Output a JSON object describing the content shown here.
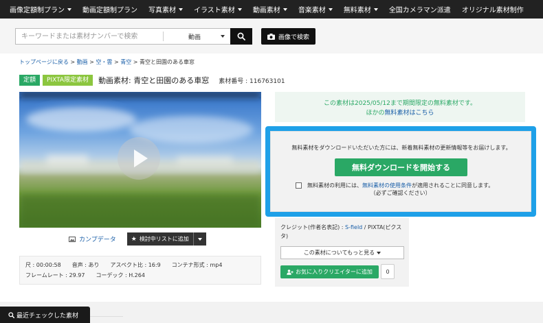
{
  "nav": {
    "items": [
      {
        "label": "画像定額制プラン",
        "dropdown": true
      },
      {
        "label": "動画定額制プラン",
        "dropdown": false
      },
      {
        "label": "写真素材",
        "dropdown": true
      },
      {
        "label": "イラスト素材",
        "dropdown": true
      },
      {
        "label": "動画素材",
        "dropdown": true
      },
      {
        "label": "音楽素材",
        "dropdown": true
      },
      {
        "label": "無料素材",
        "dropdown": true
      },
      {
        "label": "全国カメラマン派遣",
        "dropdown": false
      },
      {
        "label": "オリジナル素材制作",
        "dropdown": false
      }
    ]
  },
  "search": {
    "placeholder": "キーワードまたは素材ナンバーで検索",
    "type_selected": "動画",
    "image_search_label": "画像で検索"
  },
  "breadcrumb": {
    "top": "トップページに戻る",
    "sep": " > ",
    "video": "動画",
    "sky": "空・雲",
    "bluesky": "青空",
    "current": "青空と田園のある車窓"
  },
  "title": {
    "badge_fixed": "定額",
    "badge_limited": "PIXTA限定素材",
    "text": "動画素材: 青空と田園のある車窓",
    "material_no": "素材番号 : 116763101"
  },
  "video_actions": {
    "comp_data": "カンプデータ",
    "add_list": "検討中リストに追加"
  },
  "specs": {
    "duration": "尺 : 00:00:58",
    "audio": "音声 : あり",
    "aspect": "アスペクト比 : 16:9",
    "container": "コンテナ形式 : mp4",
    "framerate": "フレームレート : 29.97",
    "codec": "コーデック : H.264"
  },
  "free_notice": {
    "line1": "この素材は2025/05/12まで期間限定の無料素材です。",
    "line2_prefix": "ほかの",
    "line2_link": "無料素材はこちら"
  },
  "download": {
    "intro": "無料素材をダウンロードいただいた方には、新着無料素材の更新情報等をお届けします。",
    "button": "無料ダウンロードを開始する",
    "agree_prefix": "無料素材の利用には、",
    "agree_link": "無料素材の使用条件",
    "agree_suffix": "が適用されることに同意します。",
    "agree_note": "（必ずご確認ください）"
  },
  "credit": {
    "prefix": "クレジット(作者名表記) : ",
    "author": "S-field",
    "suffix": " / PIXTA(ピクスタ)",
    "more": "この素材についてもっと見る",
    "fav": "お気に入りクリエイターに追加",
    "fav_count": "0"
  },
  "recent": {
    "label": "最近チェックした素材"
  },
  "colors": {
    "accent_green": "#2aa865",
    "lime": "#8cc63f",
    "highlight_blue": "#1ea0e8",
    "link_blue": "#1a5fa8"
  }
}
